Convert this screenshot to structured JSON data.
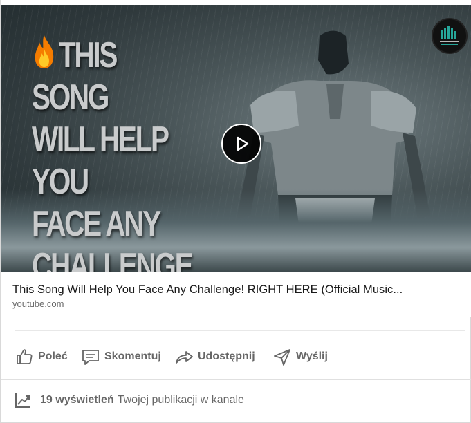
{
  "video": {
    "thumbnail_text": "THIS SONG WILL HELP YOU FACE ANY CHALLENGE",
    "thumbnail_lines": [
      "THIS SONG",
      "WILL HELP YOU",
      "FACE ANY",
      "CHALLENGE"
    ],
    "channel_logo_icon": "channel-logo-icon",
    "play_icon": "play-icon"
  },
  "link": {
    "title": "This Song Will Help You Face Any Challenge! RIGHT HERE (Official Music...",
    "domain": "youtube.com"
  },
  "actions": [
    {
      "label": "Poleć",
      "icon": "thumbs-up-icon"
    },
    {
      "label": "Skomentuj",
      "icon": "comment-icon"
    },
    {
      "label": "Udostępnij",
      "icon": "share-arrow-icon"
    },
    {
      "label": "Wyślij",
      "icon": "send-icon"
    }
  ],
  "stats": {
    "views": "19 wyświetleń",
    "suffix": "Twojej publikacji w kanale",
    "icon": "trending-chart-icon"
  },
  "colors": {
    "text_secondary": "#00000099",
    "divider": "#e0e0e0",
    "thumbnail_text": "#c9cbcc"
  }
}
